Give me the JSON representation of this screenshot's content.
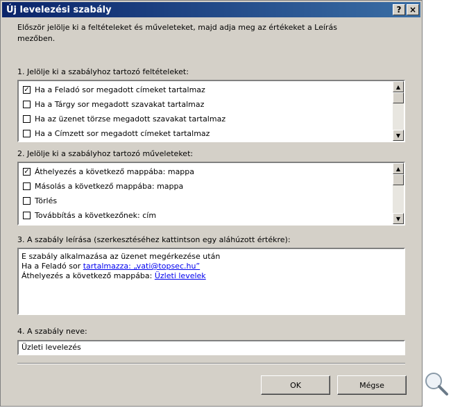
{
  "dialog": {
    "title": "Új levelezési szabály",
    "help_btn": "?",
    "close_btn": "×",
    "intro_line1": "Először jelölje ki a feltételeket és műveleteket, majd adja meg az értékeket a Leírás",
    "intro_line2": "mezőben."
  },
  "conditions": {
    "label": "1. Jelölje ki a szabályhoz tartozó feltételeket:",
    "items": [
      {
        "label": "Ha a Feladó sor megadott címeket tartalmaz",
        "mark": "✓"
      },
      {
        "label": "Ha a Tárgy sor megadott szavakat tartalmaz",
        "mark": ""
      },
      {
        "label": "Ha az üzenet törzse megadott szavakat tartalmaz",
        "mark": ""
      },
      {
        "label": "Ha a Címzett sor megadott címeket tartalmaz",
        "mark": ""
      }
    ]
  },
  "actions": {
    "label": "2. Jelölje ki a szabályhoz tartozó műveleteket:",
    "items": [
      {
        "label": "Áthelyezés a következő mappába: mappa",
        "mark": "✓"
      },
      {
        "label": "Másolás a következő mappába: mappa",
        "mark": ""
      },
      {
        "label": "Törlés",
        "mark": ""
      },
      {
        "label": "Továbbítás a következőnek: cím",
        "mark": ""
      }
    ]
  },
  "description": {
    "label": "3. A szabály leírása (szerkesztéséhez kattintson egy aláhúzott értékre):",
    "line1": "E szabály alkalmazása az üzenet megérkezése után",
    "line2_prefix": "Ha a Feladó sor ",
    "line2_link": "tartalmazza: „vati@topsec.hu”",
    "line3_prefix": "Áthelyezés a következő mappába: ",
    "line3_link": "Üzleti levelek"
  },
  "rule_name": {
    "label": "4. A szabály neve:",
    "value": "Üzleti levelezés"
  },
  "buttons": {
    "ok": "OK",
    "cancel": "Mégse"
  },
  "icons": {
    "scroll_up": "▲",
    "scroll_down": "▼",
    "magnifier": "magnifier-icon"
  }
}
